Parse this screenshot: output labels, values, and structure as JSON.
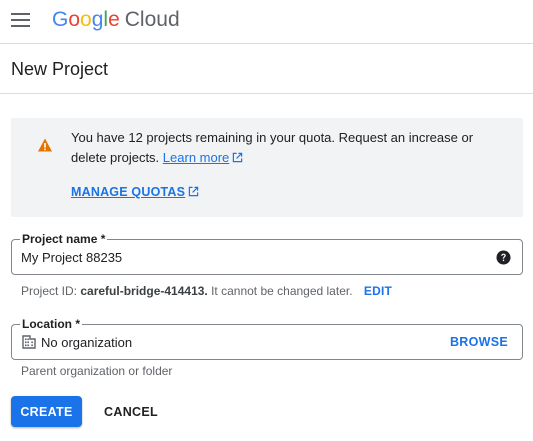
{
  "header": {
    "logo_google": [
      "G",
      "o",
      "o",
      "g",
      "l",
      "e"
    ],
    "logo_product": "Cloud"
  },
  "page": {
    "title": "New Project"
  },
  "quota_alert": {
    "text": "You have 12 projects remaining in your quota. Request an increase or delete projects.",
    "learn_more": "Learn more",
    "manage_quotas": "MANAGE QUOTAS",
    "icon": "warning-icon",
    "icon_color": "#e37400"
  },
  "project_name": {
    "label": "Project name *",
    "value": "My Project 88235",
    "help_icon": "help-icon"
  },
  "project_id": {
    "prefix": "Project ID:",
    "id": "careful-bridge-414413.",
    "suffix": "It cannot be changed later.",
    "edit": "EDIT"
  },
  "location": {
    "label": "Location *",
    "value": "No organization",
    "browse": "BROWSE",
    "hint": "Parent organization or folder",
    "icon": "organization-icon"
  },
  "actions": {
    "create": "CREATE",
    "cancel": "CANCEL"
  },
  "colors": {
    "primary": "#1a73e8",
    "warning": "#e37400",
    "alert_bg": "#f1f3f4"
  }
}
